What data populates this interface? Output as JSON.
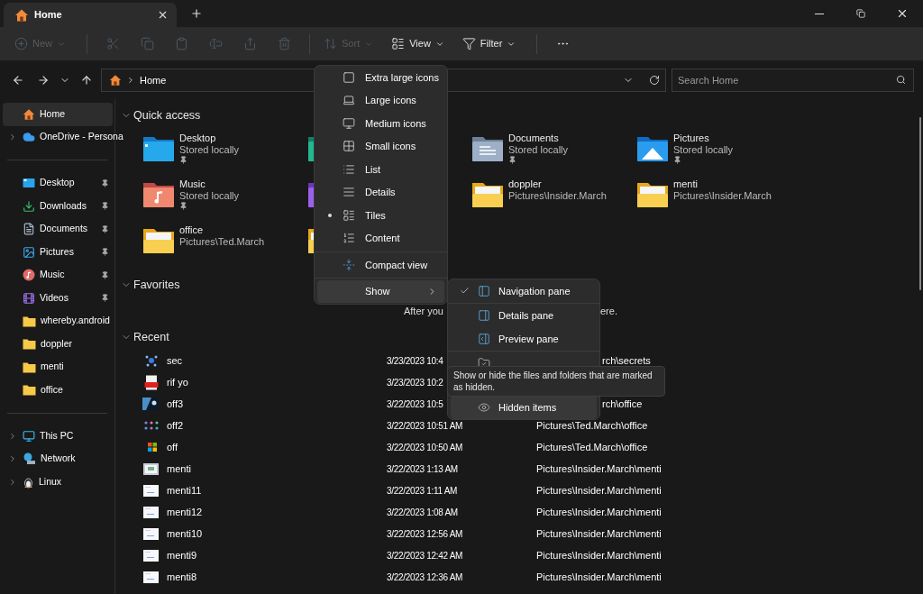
{
  "tab": {
    "title": "Home"
  },
  "toolbar": [
    {
      "kind": "new",
      "label": "New",
      "disabled": true
    },
    {
      "kind": "cut",
      "disabled": true
    },
    {
      "kind": "copy",
      "disabled": true
    },
    {
      "kind": "paste",
      "disabled": true
    },
    {
      "kind": "rename",
      "disabled": true
    },
    {
      "kind": "share",
      "disabled": true
    },
    {
      "kind": "delete",
      "disabled": true
    },
    {
      "kind": "sort",
      "label": "Sort",
      "disabled": true
    },
    {
      "kind": "view",
      "label": "View",
      "disabled": false
    },
    {
      "kind": "filter",
      "label": "Filter",
      "disabled": false
    },
    {
      "kind": "more",
      "disabled": false
    }
  ],
  "address": {
    "crumb": "Home"
  },
  "search": {
    "placeholder": "Search Home"
  },
  "sidebar": {
    "sections": [
      {
        "items": [
          {
            "kind": "home",
            "label": "Home",
            "pinned": false,
            "expandable": false,
            "selected": true
          },
          {
            "kind": "cloud",
            "label": "OneDrive - Persona",
            "pinned": false,
            "expandable": true,
            "selected": false
          }
        ]
      },
      {
        "items": [
          {
            "kind": "desktop",
            "label": "Desktop",
            "pinned": true,
            "expandable": false,
            "selected": false
          },
          {
            "kind": "downloads",
            "label": "Downloads",
            "pinned": true,
            "expandable": false,
            "selected": false
          },
          {
            "kind": "documents",
            "label": "Documents",
            "pinned": true,
            "expandable": false,
            "selected": false
          },
          {
            "kind": "pictures",
            "label": "Pictures",
            "pinned": true,
            "expandable": false,
            "selected": false
          },
          {
            "kind": "music",
            "label": "Music",
            "pinned": true,
            "expandable": false,
            "selected": false
          },
          {
            "kind": "videos",
            "label": "Videos",
            "pinned": true,
            "expandable": false,
            "selected": false
          },
          {
            "kind": "folder",
            "label": "whereby.android",
            "pinned": false,
            "expandable": false,
            "selected": false
          },
          {
            "kind": "folder",
            "label": "doppler",
            "pinned": false,
            "expandable": false,
            "selected": false
          },
          {
            "kind": "folder",
            "label": "menti",
            "pinned": false,
            "expandable": false,
            "selected": false
          },
          {
            "kind": "folder",
            "label": "office",
            "pinned": false,
            "expandable": false,
            "selected": false
          }
        ]
      },
      {
        "items": [
          {
            "kind": "pc",
            "label": "This PC",
            "pinned": false,
            "expandable": true,
            "selected": false
          },
          {
            "kind": "network",
            "label": "Network",
            "pinned": false,
            "expandable": true,
            "selected": false
          },
          {
            "kind": "linux",
            "label": "Linux",
            "pinned": false,
            "expandable": true,
            "selected": false
          }
        ]
      }
    ]
  },
  "quick_access": {
    "title": "Quick access",
    "expanded": true,
    "tiles": [
      {
        "kind": "desktop",
        "name": "Desktop",
        "detail": "Stored locally",
        "pinned": true
      },
      {
        "kind": "downloads",
        "pinned": false
      },
      {
        "kind": "documents",
        "name": "Documents",
        "detail": "Stored locally",
        "pinned": true
      },
      {
        "kind": "pictures",
        "name": "Pictures",
        "detail": "Stored locally",
        "pinned": true
      },
      {
        "kind": "music",
        "name": "Music",
        "detail": "Stored locally",
        "pinned": true
      },
      {
        "kind": "videos",
        "pinned": false
      },
      {
        "kind": "folder",
        "name": "doppler",
        "detail": "Pictures\\Insider.March",
        "pinned": false
      },
      {
        "kind": "folder",
        "name": "menti",
        "detail": "Pictures\\Insider.March",
        "pinned": false
      },
      {
        "kind": "folder",
        "name": "office",
        "detail": "Pictures\\Ted.March",
        "pinned": false
      },
      {
        "kind": "folder",
        "pinned": false
      }
    ]
  },
  "favorites": {
    "title": "Favorites",
    "expanded": true,
    "message_parts": [
      "After you",
      "ere."
    ]
  },
  "recent": {
    "title": "Recent",
    "expanded": true,
    "rows": [
      {
        "kind": "network",
        "name": "sec",
        "date": "3/23/2023 10:4",
        "path_tail": "rch\\secrets"
      },
      {
        "kind": "pdf",
        "name": "rif yo",
        "date": "3/23/2023 10:2"
      },
      {
        "kind": "photo",
        "name": "off3",
        "date": "3/22/2023 10:5",
        "path_tail": "rch\\office"
      },
      {
        "kind": "dots",
        "name": "off2",
        "date": "3/22/2023 10:51 AM",
        "path": "Pictures\\Ted.March\\office"
      },
      {
        "kind": "logo",
        "name": "off",
        "date": "3/22/2023 10:50 AM",
        "path": "Pictures\\Ted.March\\office"
      },
      {
        "kind": "screenshot",
        "name": "menti",
        "date": "3/22/2023 1:13 AM",
        "path": "Pictures\\Insider.March\\menti"
      },
      {
        "kind": "page",
        "name": "menti11",
        "date": "3/22/2023 1:11 AM",
        "path": "Pictures\\Insider.March\\menti"
      },
      {
        "kind": "page",
        "name": "menti12",
        "date": "3/22/2023 1:08 AM",
        "path": "Pictures\\Insider.March\\menti"
      },
      {
        "kind": "page",
        "name": "menti10",
        "date": "3/22/2023 12:56 AM",
        "path": "Pictures\\Insider.March\\menti"
      },
      {
        "kind": "page",
        "name": "menti9",
        "date": "3/22/2023 12:42 AM",
        "path": "Pictures\\Insider.March\\menti"
      },
      {
        "kind": "page",
        "name": "menti8",
        "date": "3/22/2023 12:36 AM",
        "path": "Pictures\\Insider.March\\menti"
      }
    ]
  },
  "view_menu": {
    "groups": [
      {
        "items": [
          {
            "kind": "xl",
            "label": "Extra large icons",
            "selected": false,
            "highlighted": false,
            "submenu": false
          },
          {
            "kind": "large",
            "label": "Large icons",
            "selected": false,
            "highlighted": false,
            "submenu": false
          },
          {
            "kind": "medium",
            "label": "Medium icons",
            "selected": false,
            "highlighted": false,
            "submenu": false
          },
          {
            "kind": "small",
            "label": "Small icons",
            "selected": false,
            "highlighted": false,
            "submenu": false
          },
          {
            "kind": "list",
            "label": "List",
            "selected": false,
            "highlighted": false,
            "submenu": false
          },
          {
            "kind": "details",
            "label": "Details",
            "selected": false,
            "highlighted": false,
            "submenu": false
          },
          {
            "kind": "tiles",
            "label": "Tiles",
            "selected": true,
            "highlighted": false,
            "submenu": false
          },
          {
            "kind": "content",
            "label": "Content",
            "selected": false,
            "highlighted": false,
            "submenu": false
          }
        ]
      },
      {
        "items": [
          {
            "kind": "compact",
            "label": "Compact view",
            "selected": false,
            "highlighted": false,
            "submenu": false
          }
        ]
      },
      {
        "items": [
          {
            "kind": "show",
            "label": "Show",
            "selected": false,
            "highlighted": true,
            "submenu": true
          }
        ]
      }
    ]
  },
  "show_menu": {
    "groups": [
      {
        "items": [
          {
            "kind": "nav",
            "label": "Navigation pane",
            "checked": true,
            "highlighted": false
          }
        ]
      },
      {
        "items": [
          {
            "kind": "details",
            "label": "Details pane",
            "checked": false,
            "highlighted": false
          },
          {
            "kind": "preview",
            "label": "Preview pane",
            "checked": false,
            "highlighted": false
          }
        ]
      },
      {
        "items": [
          {
            "kind": "checkboxes",
            "checked": false,
            "highlighted": false
          },
          {
            "kind": "hidden",
            "label": "Hidden items",
            "checked": false,
            "highlighted": true
          }
        ]
      }
    ]
  },
  "tooltip": {
    "text": "Show or hide the files and folders that are marked as hidden."
  }
}
